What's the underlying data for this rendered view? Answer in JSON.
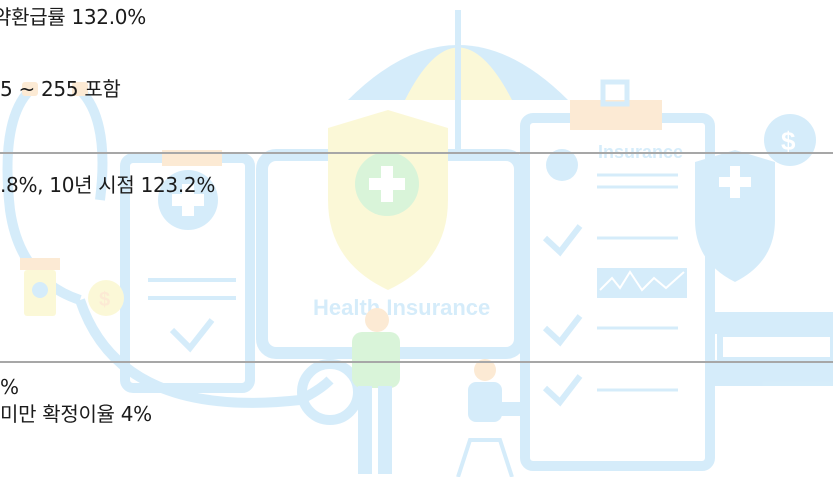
{
  "lines": {
    "line1": "약환급률 132.0%",
    "line2": "5 ~ 255 포함",
    "line3": ".8%, 10년 시점 123.2%",
    "line4": "%",
    "line5": "미만 확정이율 4%"
  },
  "illustration": {
    "caption": "Health Insurance",
    "clipboard_title": "Insurance",
    "coin_symbol": "$"
  },
  "colors": {
    "text": "#1b1b1b",
    "divider": "#a7a7a7",
    "illustration_blue": "#7fc6f1",
    "illustration_yellow": "#f5ea86",
    "illustration_orange": "#f6c07d",
    "illustration_green": "#8ce08a"
  }
}
